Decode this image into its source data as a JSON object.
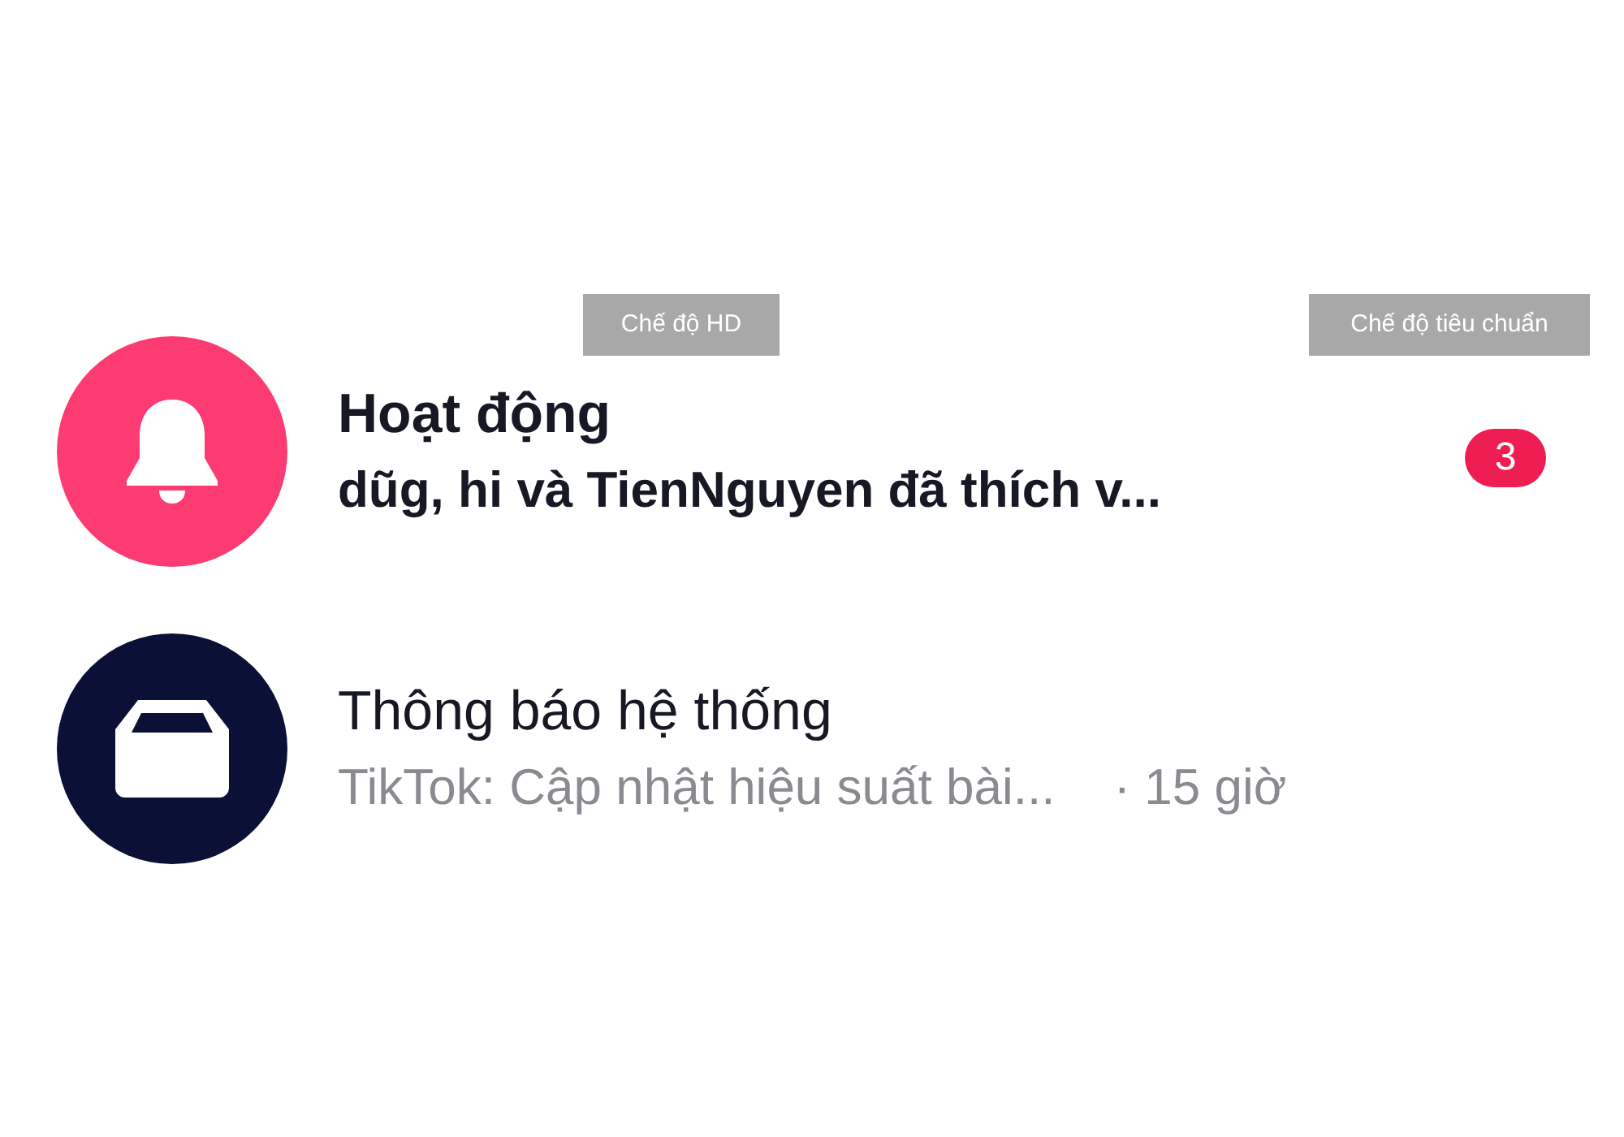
{
  "labels": [
    "Chế độ HD",
    "Chế độ tiêu chuẩn"
  ],
  "rows": [
    {
      "kind": "bell",
      "color": "#fd3b73",
      "title": "Hoạt động",
      "preview": "dũg, hi và TienNguyen đã thích v...",
      "unread": true,
      "badge": "3"
    },
    {
      "kind": "inbox",
      "color": "#0b1136",
      "title": "Thông báo hệ thống",
      "preview": "TikTok: Cập nhật hiệu suất bài...",
      "unread": false,
      "time": "· 15 giờ"
    }
  ]
}
